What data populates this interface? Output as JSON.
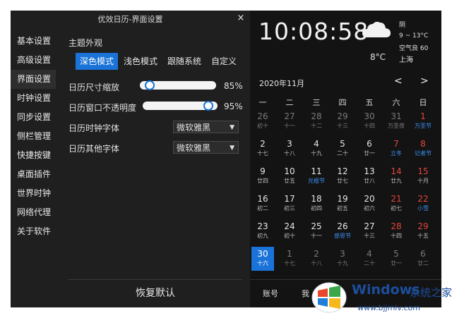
{
  "window": {
    "title": "优效日历-界面设置",
    "close_glyph": "×"
  },
  "sidebar": {
    "items": [
      {
        "label": "基本设置",
        "active": false
      },
      {
        "label": "高级设置",
        "active": false
      },
      {
        "label": "界面设置",
        "active": true
      },
      {
        "label": "时钟设置",
        "active": false
      },
      {
        "label": "同步设置",
        "active": false
      },
      {
        "label": "侧栏管理",
        "active": false
      },
      {
        "label": "快捷按键",
        "active": false
      },
      {
        "label": "桌面插件",
        "active": false
      },
      {
        "label": "世界时钟",
        "active": false
      },
      {
        "label": "网络代理",
        "active": false
      },
      {
        "label": "关于软件",
        "active": false
      }
    ]
  },
  "theme": {
    "label": "主题外观",
    "tabs": [
      {
        "label": "深色模式",
        "active": true
      },
      {
        "label": "浅色模式",
        "active": false
      },
      {
        "label": "跟随系统",
        "active": false
      },
      {
        "label": "自定义",
        "active": false
      }
    ]
  },
  "settings": {
    "scale": {
      "label": "日历尺寸缩放",
      "value_text": "85%",
      "fraction": 0.07
    },
    "opacity": {
      "label": "日历窗口不透明度",
      "value_text": "95%",
      "fraction": 0.93
    },
    "clock_font": {
      "label": "日历时钟字体",
      "value": "微软雅黑"
    },
    "other_font": {
      "label": "日历其他字体",
      "value": "微软雅黑"
    }
  },
  "reset_label": "恢复默认",
  "clock": {
    "time": "10:08:58"
  },
  "weather": {
    "condition": "阴",
    "range": "9 ~ 13°C",
    "air": "空气良 60",
    "temp": "8°C",
    "city": "上海"
  },
  "calendar": {
    "month_label": "2020年11月",
    "prev_glyph": "<",
    "next_glyph": ">",
    "weekdays": [
      "一",
      "二",
      "三",
      "四",
      "五",
      "六",
      "日"
    ],
    "weeks": [
      [
        {
          "d": "26",
          "l": "初十",
          "dim": true
        },
        {
          "d": "27",
          "l": "十一",
          "dim": true
        },
        {
          "d": "28",
          "l": "十二",
          "dim": true
        },
        {
          "d": "29",
          "l": "十三",
          "dim": true
        },
        {
          "d": "30",
          "l": "十四",
          "dim": true
        },
        {
          "d": "31",
          "l": "万圣夜",
          "dim": true
        },
        {
          "d": "1",
          "l": "万圣节",
          "weekend": true,
          "fest": true
        }
      ],
      [
        {
          "d": "2",
          "l": "十七"
        },
        {
          "d": "3",
          "l": "十八"
        },
        {
          "d": "4",
          "l": "十九"
        },
        {
          "d": "5",
          "l": "二十"
        },
        {
          "d": "6",
          "l": "廿一"
        },
        {
          "d": "7",
          "l": "立冬",
          "weekend": true,
          "fest": true
        },
        {
          "d": "8",
          "l": "记者节",
          "weekend": true,
          "fest": true
        }
      ],
      [
        {
          "d": "9",
          "l": "廿四"
        },
        {
          "d": "10",
          "l": "廿五"
        },
        {
          "d": "11",
          "l": "光棍节",
          "fest": true
        },
        {
          "d": "12",
          "l": "廿七"
        },
        {
          "d": "13",
          "l": "廿八"
        },
        {
          "d": "14",
          "l": "廿九",
          "weekend": true
        },
        {
          "d": "15",
          "l": "十月",
          "weekend": true
        }
      ],
      [
        {
          "d": "16",
          "l": "初二"
        },
        {
          "d": "17",
          "l": "初三"
        },
        {
          "d": "18",
          "l": "初四"
        },
        {
          "d": "19",
          "l": "初五"
        },
        {
          "d": "20",
          "l": "初六"
        },
        {
          "d": "21",
          "l": "初七",
          "weekend": true
        },
        {
          "d": "22",
          "l": "小雪",
          "weekend": true,
          "fest": true
        }
      ],
      [
        {
          "d": "23",
          "l": "初九"
        },
        {
          "d": "24",
          "l": "初十"
        },
        {
          "d": "25",
          "l": "十一"
        },
        {
          "d": "26",
          "l": "感恩节",
          "fest": true
        },
        {
          "d": "27",
          "l": "十三"
        },
        {
          "d": "28",
          "l": "十四",
          "weekend": true
        },
        {
          "d": "29",
          "l": "十五",
          "weekend": true
        }
      ],
      [
        {
          "d": "30",
          "l": "十六",
          "today": true
        },
        {
          "d": "1",
          "l": "十七",
          "dim": true
        },
        {
          "d": "2",
          "l": "十八",
          "dim": true
        },
        {
          "d": "3",
          "l": "十九",
          "dim": true
        },
        {
          "d": "4",
          "l": "二十",
          "dim": true
        },
        {
          "d": "5",
          "l": "廿一",
          "dim": true
        },
        {
          "d": "6",
          "l": "廿二",
          "dim": true
        }
      ]
    ]
  },
  "footer": {
    "account": "账号",
    "my": "我"
  },
  "watermark": {
    "brand": "Windows",
    "suffix": "系统之家",
    "url": "www.bjjmlv.com"
  },
  "colors": {
    "accent": "#1a73d9",
    "weekend": "#e0463c",
    "festival": "#3b8ef0",
    "dim": "#7a7a7a"
  }
}
